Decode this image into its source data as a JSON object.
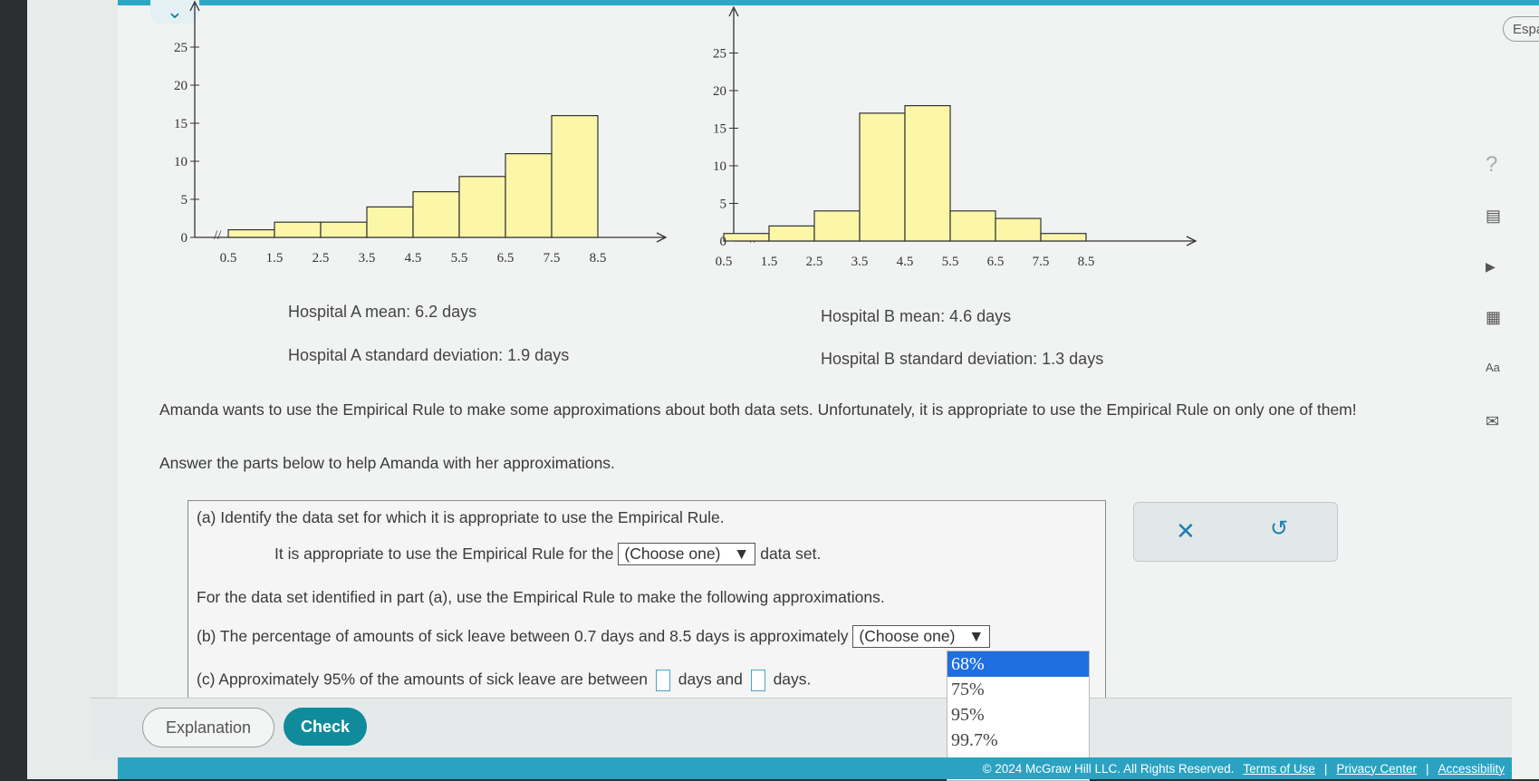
{
  "left_stats": {
    "mean": "Hospital A mean: 6.2 days",
    "sd": "Hospital A standard deviation: 1.9 days"
  },
  "right_stats": {
    "mean": "Hospital B mean: 4.6 days",
    "sd": "Hospital B standard deviation: 1.3 days"
  },
  "paragraph1": "Amanda wants to use the Empirical Rule to make some approximations about both data sets. Unfortunately, it is appropriate to use the Empirical Rule on only one of them!",
  "paragraph2": "Answer the parts below to help Amanda with her approximations.",
  "question": {
    "a_label": "(a) Identify the data set for which it is appropriate to use the Empirical Rule.",
    "a_pre": "It is appropriate to use the Empirical Rule for the",
    "a_select": "(Choose one)",
    "a_post": "data set.",
    "intro": "For the data set identified in part (a), use the Empirical Rule to make the following approximations.",
    "b_text": "(b) The percentage of amounts of sick leave between 0.7 days and 8.5 days is approximately",
    "b_select": "(Choose one)",
    "c_pre": "(c) Approximately 95% of the amounts of sick leave are between",
    "c_mid": "days and",
    "c_post": "days."
  },
  "dropdown_options": [
    "68%",
    "75%",
    "95%",
    "99.7%"
  ],
  "selected_option": "68%",
  "buttons": {
    "explanation": "Explanation",
    "check": "Check",
    "language": "Espa"
  },
  "footer": {
    "copyright": "© 2024 McGraw Hill LLC. All Rights Reserved.",
    "terms": "Terms of Use",
    "privacy": "Privacy Center",
    "accessibility": "Accessibility"
  },
  "colors": {
    "bar_fill": "#fbf6a8",
    "accent": "#108b9c",
    "top_bar": "#2aa8c4"
  },
  "chart_data": [
    {
      "type": "bar",
      "title": "",
      "xlabel": "",
      "ylabel": "",
      "ylim": [
        0,
        25
      ],
      "yticks": [
        "0",
        "5",
        "10",
        "15",
        "20",
        "25"
      ],
      "categories": [
        "0.5",
        "1.5",
        "2.5",
        "3.5",
        "4.5",
        "5.5",
        "6.5",
        "7.5",
        "8.5"
      ],
      "values": [
        1,
        2,
        2,
        4,
        6,
        8,
        11,
        16
      ]
    },
    {
      "type": "bar",
      "title": "",
      "xlabel": "",
      "ylabel": "",
      "ylim": [
        0,
        25
      ],
      "yticks": [
        "0",
        "5",
        "10",
        "15",
        "20",
        "25"
      ],
      "categories": [
        "0.5",
        "1.5",
        "2.5",
        "3.5",
        "4.5",
        "5.5",
        "6.5",
        "7.5",
        "8.5"
      ],
      "values": [
        1,
        2,
        4,
        17,
        18,
        4,
        3,
        1
      ]
    }
  ]
}
